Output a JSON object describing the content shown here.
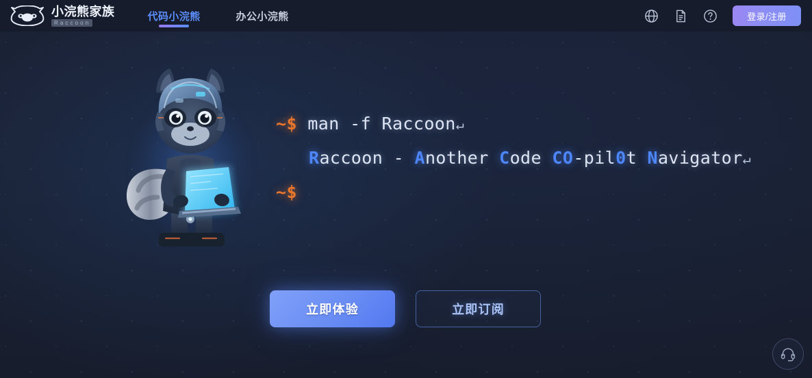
{
  "header": {
    "logo": {
      "icon": "raccoon-face-logo-icon",
      "name_cn": "小浣熊家族",
      "name_en": "Raccoon"
    },
    "nav": [
      {
        "label": "代码小浣熊",
        "active": true
      },
      {
        "label": "办公小浣熊",
        "active": false
      }
    ],
    "icons": [
      {
        "name": "globe-icon",
        "title": "语言"
      },
      {
        "name": "document-icon",
        "title": "文档"
      },
      {
        "name": "help-icon",
        "title": "帮助"
      }
    ],
    "login_button": "登录/注册"
  },
  "hero": {
    "mascot_alt": "raccoon-mascot-with-laptop",
    "terminal": {
      "line1": {
        "prompt": "~$",
        "command": "man -f Raccoon",
        "return_glyph": "↵"
      },
      "line2": {
        "segments": [
          {
            "text": "R",
            "highlight": true
          },
          {
            "text": "accoon - ",
            "highlight": false
          },
          {
            "text": "A",
            "highlight": true
          },
          {
            "text": "nother ",
            "highlight": false
          },
          {
            "text": "C",
            "highlight": true
          },
          {
            "text": "ode ",
            "highlight": false
          },
          {
            "text": "CO",
            "highlight": true
          },
          {
            "text": "-pil",
            "highlight": false
          },
          {
            "text": "0",
            "highlight": true
          },
          {
            "text": "t ",
            "highlight": false
          },
          {
            "text": "N",
            "highlight": true
          },
          {
            "text": "avigator",
            "highlight": false
          }
        ],
        "return_glyph": "↵"
      },
      "line3": {
        "prompt": "~$"
      }
    },
    "buttons": {
      "primary": "立即体验",
      "secondary": "立即订阅"
    }
  },
  "support_fab": {
    "icon": "headset-icon",
    "title": "客服"
  },
  "colors": {
    "page_bg": "#1a2133",
    "header_bg": "#161c2b",
    "accent_blue": "#5b8dfb",
    "highlight_blue": "#4d86fb",
    "prompt_orange": "#e8762c",
    "login_gradient_from": "#9b86f2",
    "login_gradient_to": "#7d8ff6",
    "primary_btn_from": "#80a0f8",
    "primary_btn_to": "#5278ef",
    "secondary_btn_border": "#46619f",
    "tab_underline_from": "#9a7bf0",
    "tab_underline_to": "#5a8df9"
  }
}
